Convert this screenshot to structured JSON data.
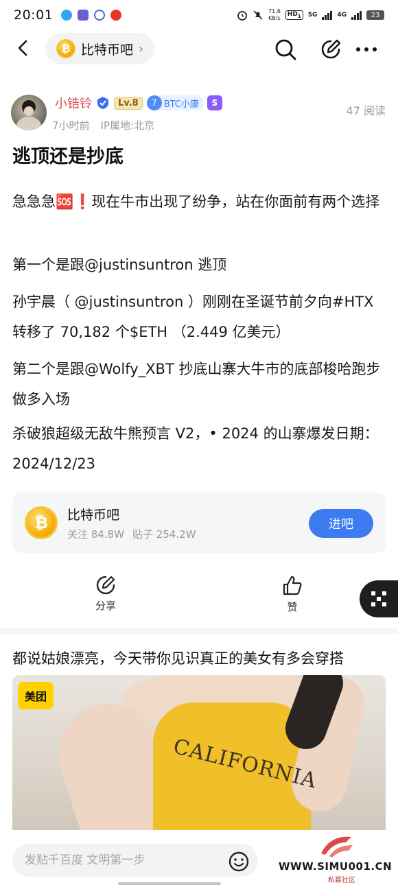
{
  "status_bar": {
    "time": "20:01",
    "net_speed_value": "71.6",
    "net_speed_unit": "KB/s",
    "hd_label": "HD",
    "hd_sub": "1",
    "net_5g": "5G",
    "net_4g": "4G",
    "battery": "23"
  },
  "nav": {
    "forum_name": "比特币吧",
    "forum_chevron": "›"
  },
  "post": {
    "author": "小锆铃",
    "level": "Lv.8",
    "badge_num": "7",
    "badge_text": "BTC小康",
    "time_ago": "7小时前",
    "ip_location": "IP属地:北京",
    "views": "47 阅读",
    "title": "逃顶还是抄底",
    "paragraphs": [
      "急急急🆘❗现在牛市出现了纷争，站在你面前有两个选择",
      "第一个是跟@justinsuntron 逃顶",
      "孙宇晨（ @justinsuntron ）刚刚在圣诞节前夕向#HTX 转移了 70,182 个$ETH （2.449 亿美元）",
      "第二个是跟@Wolfy_XBT 抄底山寨大牛市的底部梭哈跑步做多入场",
      "杀破狼超级无敌牛熊预言 V2，• 2024 的山寨爆发日期：2024/12/23"
    ]
  },
  "forum_card": {
    "name": "比特币吧",
    "followers": "关注 84.8W",
    "posts": "贴子 254.2W",
    "join_label": "进吧"
  },
  "actions": {
    "share_label": "分享",
    "like_label": "赞"
  },
  "ad": {
    "title": "都说姑娘漂亮，今天带你见识真正的美女有多会穿搭",
    "logo_text": "美团",
    "shirt_text": "CALIFORNIA"
  },
  "bottom_bar": {
    "input_placeholder": "发贴千百度 文明第一步"
  },
  "watermark": {
    "url": "WWW.SIMU001.CN",
    "subtitle": "私募社区"
  },
  "colors": {
    "accent_blue": "#3d7cf0",
    "author_red": "#e2474f",
    "coin_gold": "#f2a900"
  },
  "icons": {
    "back": "back-arrow-icon",
    "search": "search-icon",
    "edit": "edit-icon",
    "more": "more-dots-icon",
    "share": "share-icon",
    "like": "thumbs-up-icon",
    "emoji": "emoji-smile-icon",
    "float": "qr-grid-icon"
  }
}
